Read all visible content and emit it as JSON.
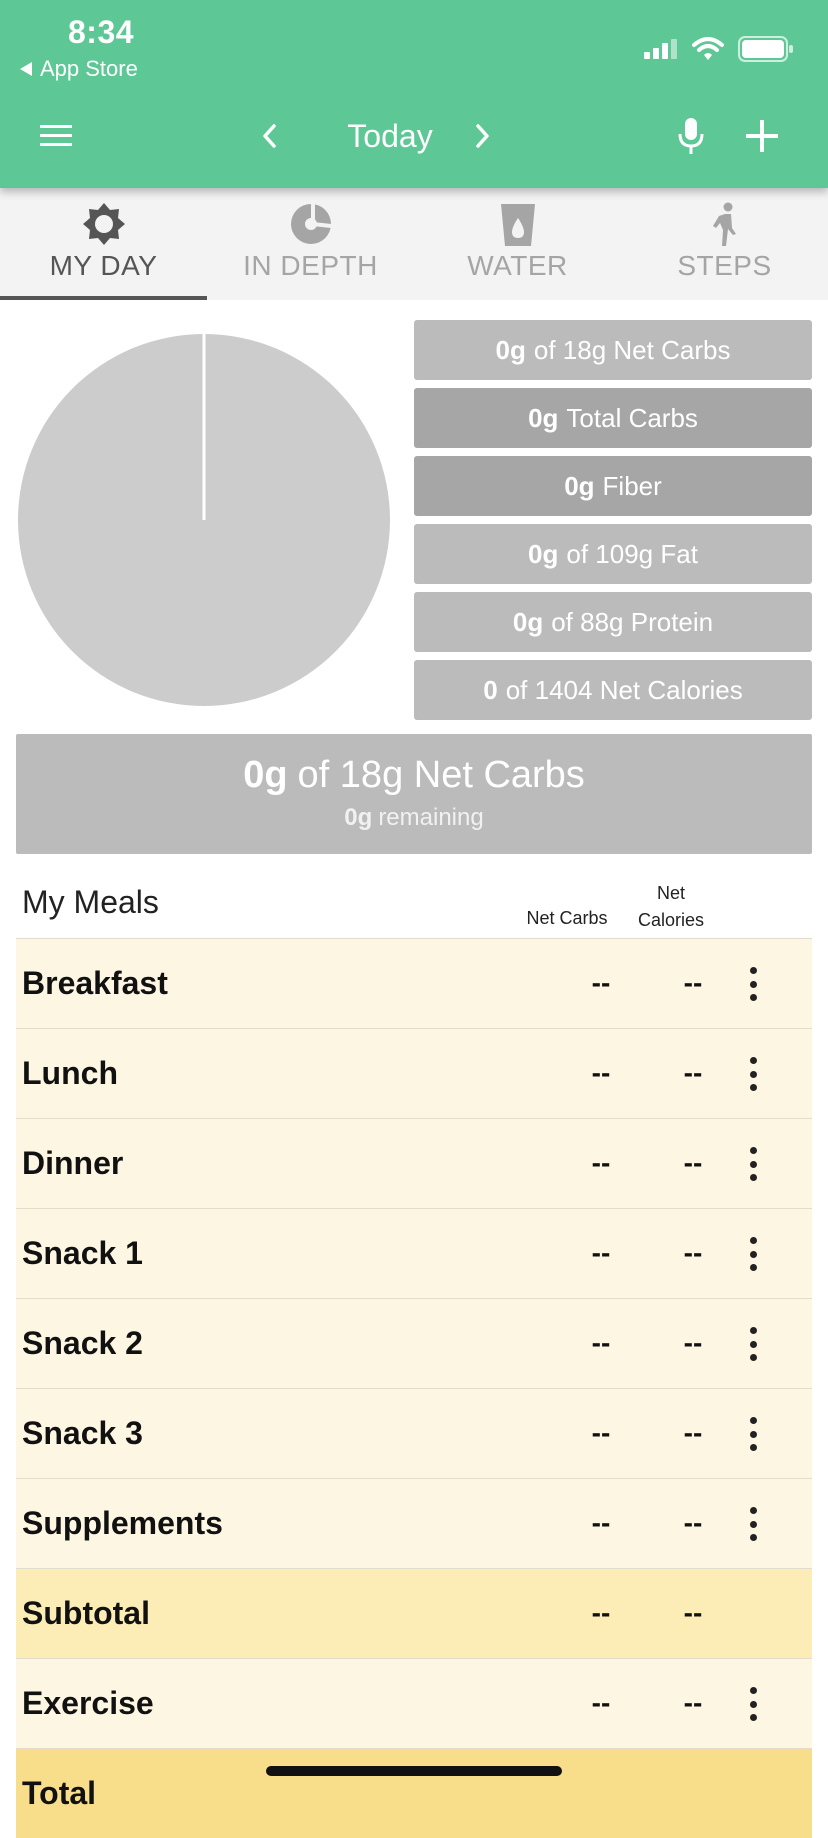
{
  "status_bar": {
    "time": "8:34",
    "back_app": "App Store"
  },
  "nav": {
    "date_label": "Today"
  },
  "tabs": [
    {
      "label": "MY DAY",
      "icon": "sun-icon",
      "active": true
    },
    {
      "label": "IN DEPTH",
      "icon": "pie-chart-icon",
      "active": false
    },
    {
      "label": "WATER",
      "icon": "water-glass-icon",
      "active": false
    },
    {
      "label": "STEPS",
      "icon": "walking-person-icon",
      "active": false
    }
  ],
  "macros": [
    {
      "value": "0g",
      "text": "of 18g Net Carbs"
    },
    {
      "value": "0g",
      "text": "Total Carbs"
    },
    {
      "value": "0g",
      "text": "Fiber"
    },
    {
      "value": "0g",
      "text": "of 109g Fat"
    },
    {
      "value": "0g",
      "text": "of 88g Protein"
    },
    {
      "value": "0",
      "text": "of 1404 Net Calories"
    }
  ],
  "summary": {
    "value": "0g",
    "text": "of 18g Net Carbs",
    "remaining_value": "0g",
    "remaining_text": "remaining"
  },
  "meals_header": {
    "title": "My Meals",
    "col_net_carbs": "Net Carbs",
    "col_net_calories_line1": "Net",
    "col_net_calories_line2": "Calories"
  },
  "meals": [
    {
      "name": "Breakfast",
      "net_carbs": "--",
      "net_calories": "--"
    },
    {
      "name": "Lunch",
      "net_carbs": "--",
      "net_calories": "--"
    },
    {
      "name": "Dinner",
      "net_carbs": "--",
      "net_calories": "--"
    },
    {
      "name": "Snack 1",
      "net_carbs": "--",
      "net_calories": "--"
    },
    {
      "name": "Snack 2",
      "net_carbs": "--",
      "net_calories": "--"
    },
    {
      "name": "Snack 3",
      "net_carbs": "--",
      "net_calories": "--"
    },
    {
      "name": "Supplements",
      "net_carbs": "--",
      "net_calories": "--"
    },
    {
      "name": "Subtotal",
      "net_carbs": "--",
      "net_calories": "--"
    },
    {
      "name": "Exercise",
      "net_carbs": "--",
      "net_calories": "--"
    },
    {
      "name": "Total",
      "net_carbs": "",
      "net_calories": ""
    }
  ],
  "colors": {
    "header_green": "#5dc795",
    "meal_row_bg": "#fdf6e3",
    "subtotal_bg": "#fcecb6",
    "total_bg": "#f8de8b",
    "macro_gray": "#bbbbbb"
  }
}
